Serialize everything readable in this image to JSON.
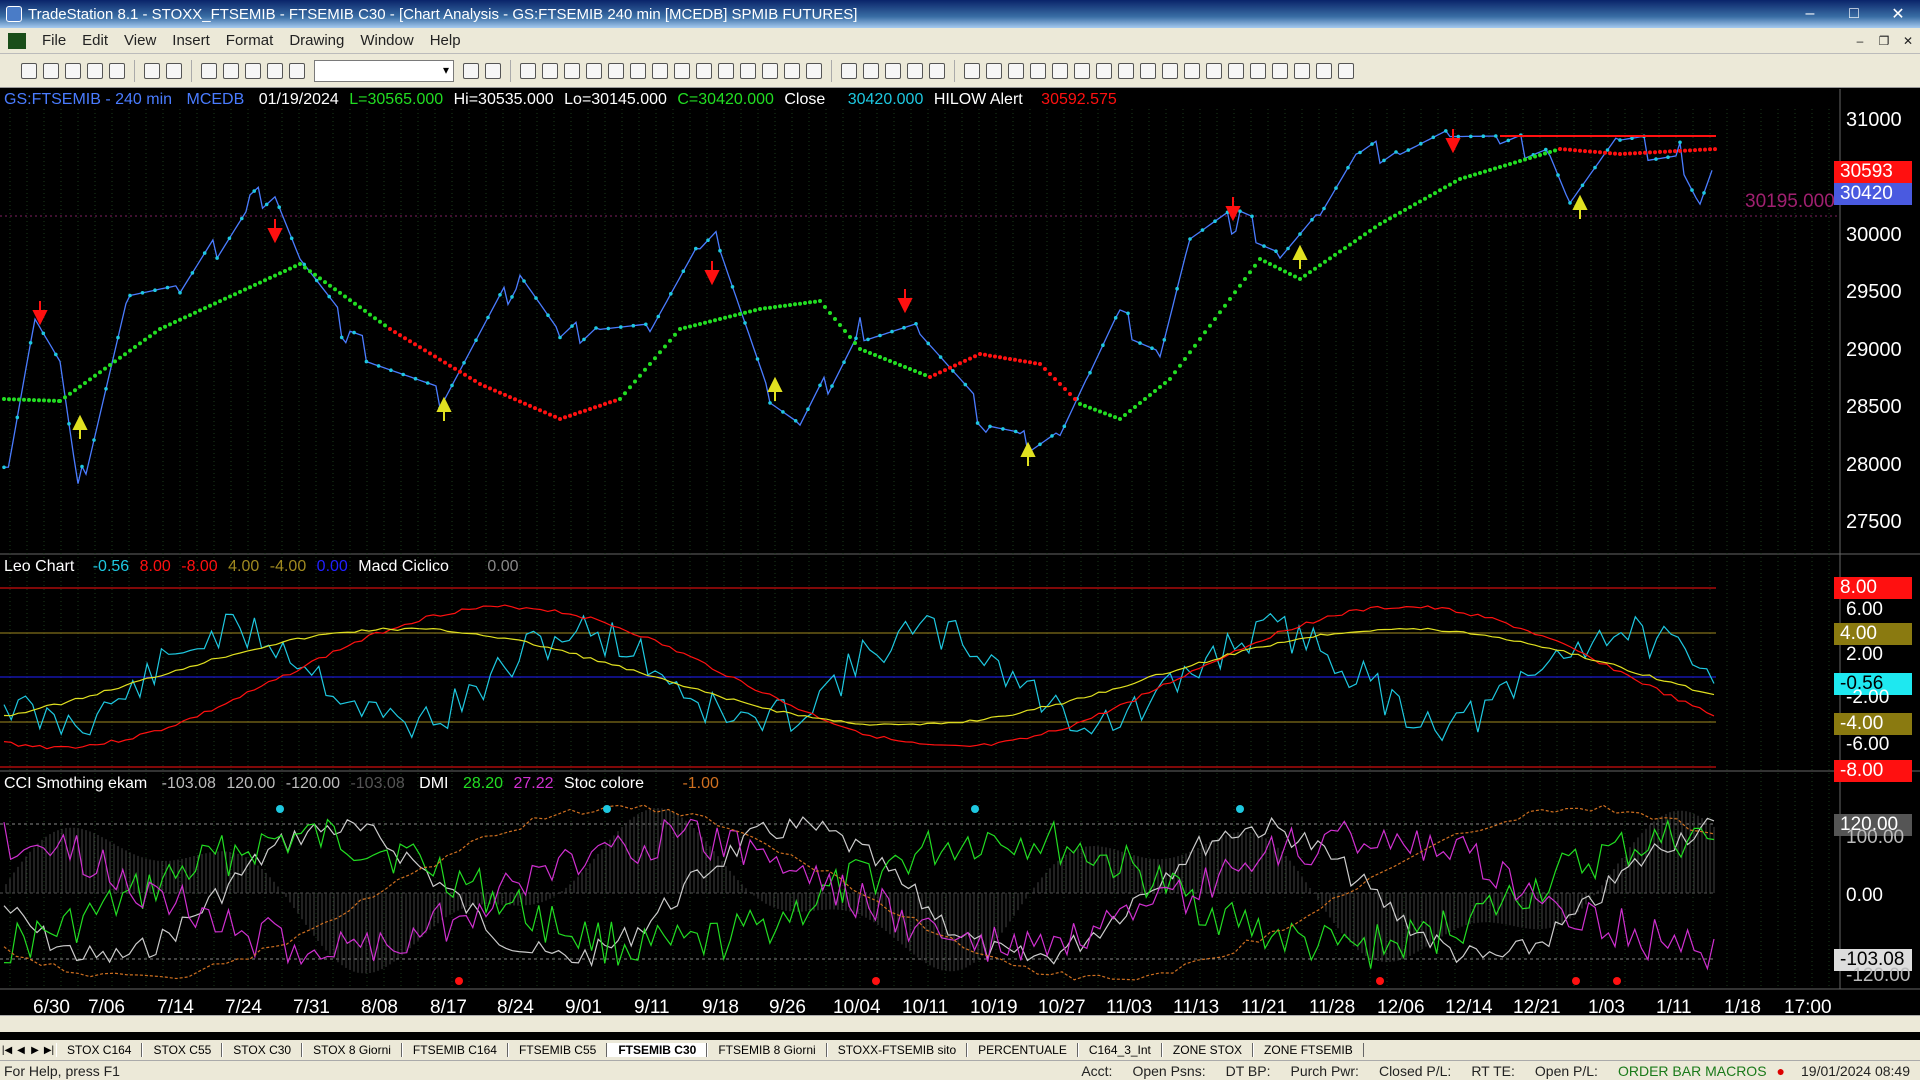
{
  "window": {
    "title": "TradeStation 8.1 - STOXX_FTSEMIB - FTSEMIB C30 - [Chart Analysis - GS:FTSEMIB  240 min  [MCEDB] SPMIB FUTURES]"
  },
  "menu": [
    "File",
    "Edit",
    "View",
    "Insert",
    "Format",
    "Drawing",
    "Window",
    "Help"
  ],
  "price_header": {
    "symbol": "GS:FTSEMIB - 240 min",
    "source": "MCEDB",
    "date": "01/19/2024",
    "low_label": "L=30565.000",
    "hi": "Hi=30535.000",
    "lo": "Lo=30145.000",
    "close": "C=30420.000",
    "close_word": "Close",
    "close_value": "30420.000",
    "alert_name": "HILOW Alert",
    "alert_value": "30592.575"
  },
  "leo_header": {
    "name": "Leo Chart",
    "values": [
      "-0.56",
      "8.00",
      "-8.00",
      "4.00",
      "-4.00",
      "0.00"
    ],
    "name2": "Macd Ciclico",
    "value2": "0.00"
  },
  "cci_header": {
    "name": "CCI Smothing ekam",
    "values": [
      "-103.08",
      "120.00",
      "-120.00",
      "-103.08"
    ],
    "name2": "DMI",
    "dmi_values": [
      "28.20",
      "27.22"
    ],
    "name3": "Stoc colore",
    "value3": "-1.00"
  },
  "price_axis": [
    "31000",
    "30500",
    "30000",
    "29500",
    "29000",
    "28500",
    "28000",
    "27500"
  ],
  "price_tags": {
    "alert": "30593",
    "last": "30420",
    "level_line": "30195.000"
  },
  "leo_axis": [
    "8.00",
    "6.00",
    "4.00",
    "2.00",
    "-0.56",
    "-2.00",
    "-4.00",
    "-6.00",
    "-8.00"
  ],
  "cci_axis": [
    "120.00",
    "100.00",
    "0.00",
    "-103.08",
    "-120.00"
  ],
  "x_axis": [
    "6/30",
    "7/06",
    "7/14",
    "7/24",
    "7/31",
    "8/08",
    "8/17",
    "8/24",
    "9/01",
    "9/11",
    "9/18",
    "9/26",
    "10/04",
    "10/11",
    "10/19",
    "10/27",
    "11/03",
    "11/13",
    "11/21",
    "11/28",
    "12/06",
    "12/14",
    "12/21",
    "1/03",
    "1/11",
    "1/18",
    "17:00"
  ],
  "tabs": [
    "STOX C164",
    "STOX C55",
    "STOX  C30",
    "STOX  8 Giorni",
    "FTSEMIB C164",
    "FTSEMIB C55",
    "FTSEMIB C30",
    "FTSEMIB  8 Giorni",
    "STOXX-FTSEMIB sito",
    "PERCENTUALE",
    "C164_3_Int",
    "ZONE STOX",
    "ZONE FTSEMIB"
  ],
  "active_tab": "FTSEMIB C30",
  "status": {
    "help": "For Help, press F1",
    "cells": [
      "Acct:",
      "Open Psns:",
      "DT BP:",
      "Purch Pwr:",
      "Closed P/L:",
      "RT TE:",
      "Open P/L:"
    ],
    "order_bar": "ORDER BAR  MACROS",
    "datetime": "19/01/2024 08:49"
  },
  "colors": {
    "bg": "#000000",
    "price": "#4a7cff",
    "alert_red": "#ff1010",
    "trend_green": "#22dd22",
    "cyan": "#1ec8e0",
    "yellow": "#e0e020",
    "magenta": "#d030d0",
    "orange": "#d07020"
  }
}
